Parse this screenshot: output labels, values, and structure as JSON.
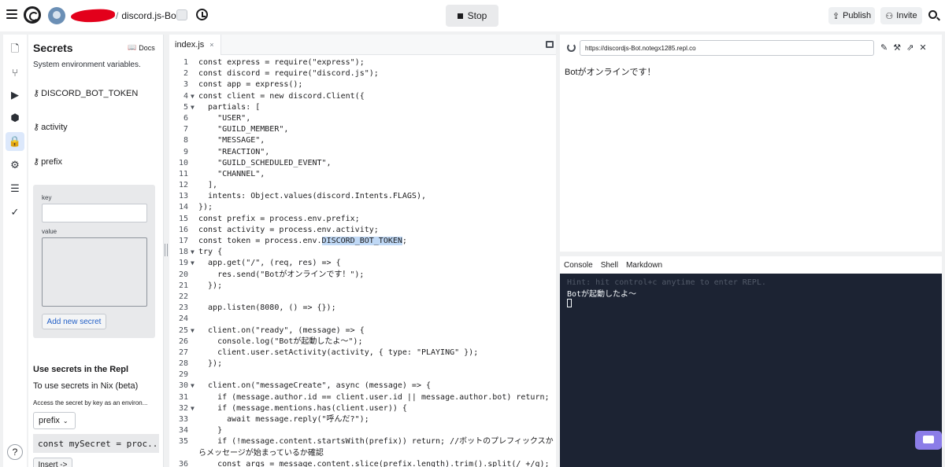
{
  "topbar": {
    "repl_name": "discord.js-Bot",
    "stop_label": "Stop",
    "publish_label": "Publish",
    "invite_label": "Invite"
  },
  "secrets": {
    "title": "Secrets",
    "docs_label": "Docs",
    "subtitle": "System environment variables.",
    "items": [
      "DISCORD_BOT_TOKEN",
      "activity",
      "prefix"
    ],
    "form": {
      "key_label": "key",
      "value_label": "value",
      "add_button": "Add new secret"
    },
    "use_title": "Use secrets in the Repl",
    "use_desc": "To use secrets in Nix (beta)",
    "access_desc": "Access the secret by key as an environ...",
    "selected_key": "prefix",
    "code_snippet": "const mySecret = proc...",
    "insert_button": "Insert ->"
  },
  "editor": {
    "tab_label": "index.js",
    "lines": [
      {
        "n": "1",
        "fold": "",
        "text": "const express = require(\"express\");"
      },
      {
        "n": "2",
        "fold": "",
        "text": "const discord = require(\"discord.js\");"
      },
      {
        "n": "3",
        "fold": "",
        "text": "const app = express();"
      },
      {
        "n": "4",
        "fold": "▼",
        "text": "const client = new discord.Client({"
      },
      {
        "n": "5",
        "fold": "▼",
        "text": "  partials: ["
      },
      {
        "n": "6",
        "fold": "",
        "text": "    \"USER\","
      },
      {
        "n": "7",
        "fold": "",
        "text": "    \"GUILD_MEMBER\","
      },
      {
        "n": "8",
        "fold": "",
        "text": "    \"MESSAGE\","
      },
      {
        "n": "9",
        "fold": "",
        "text": "    \"REACTION\","
      },
      {
        "n": "10",
        "fold": "",
        "text": "    \"GUILD_SCHEDULED_EVENT\","
      },
      {
        "n": "11",
        "fold": "",
        "text": "    \"CHANNEL\","
      },
      {
        "n": "12",
        "fold": "",
        "text": "  ],"
      },
      {
        "n": "13",
        "fold": "",
        "text": "  intents: Object.values(discord.Intents.FLAGS),"
      },
      {
        "n": "14",
        "fold": "",
        "text": "});"
      },
      {
        "n": "15",
        "fold": "",
        "text": "const prefix = process.env.prefix;"
      },
      {
        "n": "16",
        "fold": "",
        "text": "const activity = process.env.activity;"
      },
      {
        "n": "17",
        "fold": "",
        "text": "const token = process.env.DISCORD_BOT_TOKEN;"
      },
      {
        "n": "18",
        "fold": "▼",
        "text": "try {"
      },
      {
        "n": "19",
        "fold": "▼",
        "text": "  app.get(\"/\", (req, res) => {"
      },
      {
        "n": "20",
        "fold": "",
        "text": "    res.send(\"Botがオンラインです！\");"
      },
      {
        "n": "21",
        "fold": "",
        "text": "  });"
      },
      {
        "n": "22",
        "fold": "",
        "text": ""
      },
      {
        "n": "23",
        "fold": "",
        "text": "  app.listen(8080, () => {});"
      },
      {
        "n": "24",
        "fold": "",
        "text": ""
      },
      {
        "n": "25",
        "fold": "▼",
        "text": "  client.on(\"ready\", (message) => {"
      },
      {
        "n": "26",
        "fold": "",
        "text": "    console.log(\"Botが起動したよ〜\");"
      },
      {
        "n": "27",
        "fold": "",
        "text": "    client.user.setActivity(activity, { type: \"PLAYING\" });"
      },
      {
        "n": "28",
        "fold": "",
        "text": "  });"
      },
      {
        "n": "29",
        "fold": "",
        "text": ""
      },
      {
        "n": "30",
        "fold": "▼",
        "text": "  client.on(\"messageCreate\", async (message) => {"
      },
      {
        "n": "31",
        "fold": "",
        "text": "    if (message.author.id == client.user.id || message.author.bot) return;"
      },
      {
        "n": "32",
        "fold": "▼",
        "text": "    if (message.mentions.has(client.user)) {"
      },
      {
        "n": "33",
        "fold": "",
        "text": "      await message.reply(\"呼んだ?\");"
      },
      {
        "n": "34",
        "fold": "",
        "text": "    }"
      },
      {
        "n": "35",
        "fold": "",
        "text": "    if (!message.content.startsWith(prefix)) return; //ボットのプレフィックスか"
      },
      {
        "n": "",
        "fold": "",
        "text": "らメッセージが始まっているか確認"
      },
      {
        "n": "36",
        "fold": "",
        "text": "    const args = message.content.slice(prefix.length).trim().split(/ +/g);"
      }
    ]
  },
  "webview": {
    "url": "https://discordjs-Bot.notegx1285.repl.co",
    "content": "Botがオンラインです！"
  },
  "console": {
    "tabs": [
      "Console",
      "Shell",
      "Markdown"
    ],
    "hint": "Hint: hit control+c anytime to enter REPL.",
    "output": "Botが起動したよ〜"
  }
}
